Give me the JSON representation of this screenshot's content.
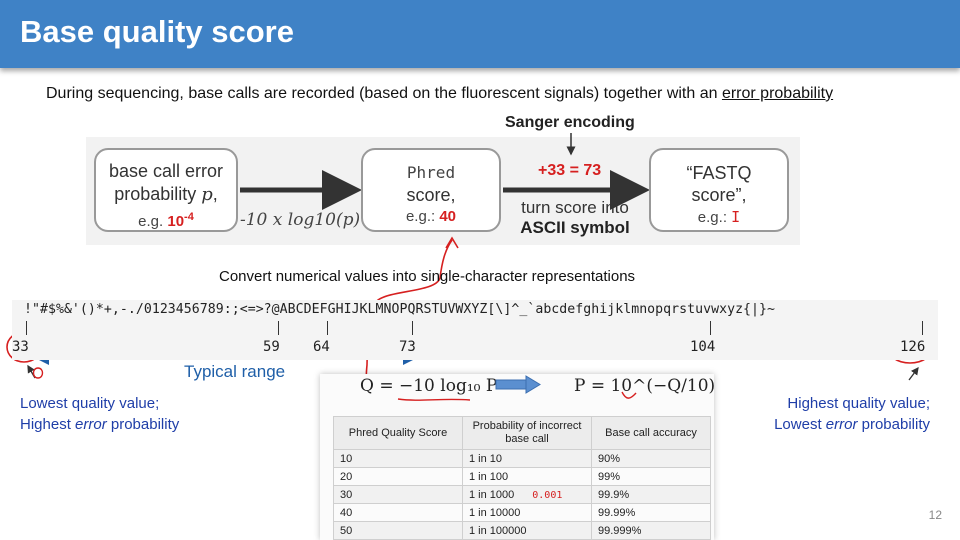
{
  "slide": {
    "title": "Base quality score",
    "intro_prefix": "During sequencing, base calls are recorded (based on the fluorescent signals) together with an ",
    "intro_link": "error probability",
    "page_number": "12"
  },
  "pipeline": {
    "sanger_label": "Sanger encoding",
    "box1_line1": "base call error",
    "box1_line2": "probability ",
    "box1_var": "p",
    "box1_eg": "e.g. ",
    "box1_value": "10",
    "box1_exp": "-4",
    "formula": "-10 x log10(p)",
    "box2_line1": "Phred",
    "box2_line2": "score,",
    "box2_eg": "e.g.: ",
    "box2_value": "40",
    "plus33": "+33 = 73",
    "turn_line1": "turn score into",
    "turn_line2": "ASCII symbol",
    "box3_line1": "“FASTQ",
    "box3_line2": "score”,",
    "box3_eg": "e.g.: ",
    "box3_value": "I"
  },
  "ascii_scale": {
    "caption": "Convert numerical values into single-character representations",
    "characters": "!\"#$%&'()*+,-./0123456789:;<=>?@ABCDEFGHIJKLMNOPQRSTUVWXYZ[\\]^_`abcdefghijklmnopqrstuvwxyz{|}~",
    "markers": [
      "33",
      "59",
      "64",
      "73",
      "104",
      "126"
    ],
    "typical_range": "Typical range",
    "low_line1": "Lowest  quality value;",
    "low_line2a": "Highest  ",
    "low_line2b": "error",
    "low_line2c": " probability",
    "high_line1": "Highest  quality value;",
    "high_line2a": "Lowest  ",
    "high_line2b": "error",
    "high_line2c": " probability"
  },
  "equations": {
    "left": "Q = −10 log₁₀ P",
    "right": "P = 10^(−Q/10)"
  },
  "quality_table": {
    "headers": [
      "Phred Quality Score",
      "Probability of incorrect base call",
      "Base call accuracy"
    ],
    "rows": [
      [
        "10",
        "1 in 10",
        "90%"
      ],
      [
        "20",
        "1 in 100",
        "99%"
      ],
      [
        "30",
        "1 in 1000",
        "99.9%"
      ],
      [
        "40",
        "1 in 10000",
        "99.99%"
      ],
      [
        "50",
        "1 in 100000",
        "99.999%"
      ]
    ],
    "annotation": "0.001"
  },
  "colors": {
    "header_bg": "#3f82c6",
    "accent_red": "#d62020",
    "accent_blue": "#1f5fa8"
  }
}
